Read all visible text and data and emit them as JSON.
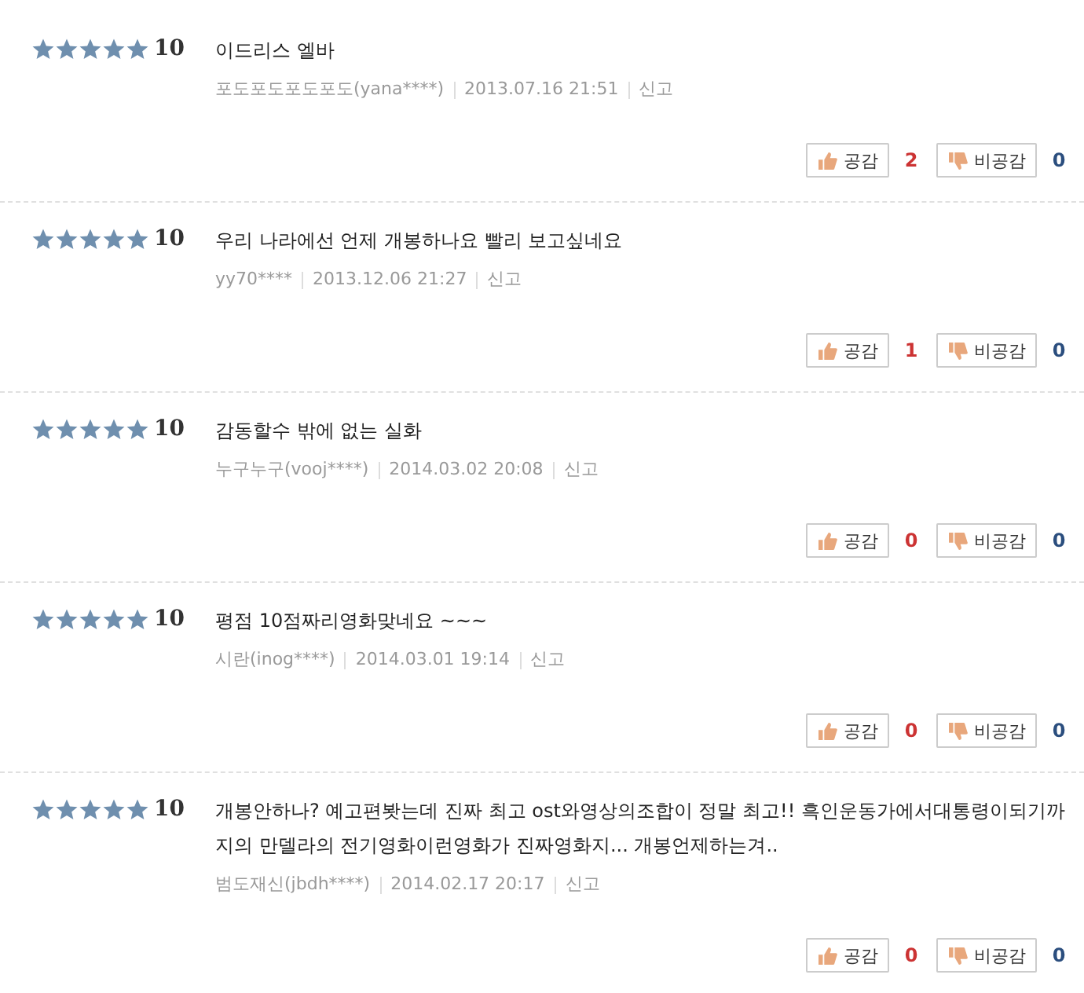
{
  "reviews": [
    {
      "stars": 5,
      "score": "10",
      "text": "이드리스 엘바",
      "author": "포도포도포도포도(yana****)",
      "date": "2013.07.16 21:51",
      "report": "신고",
      "like_label": "공감",
      "like_count": "2",
      "dislike_label": "비공감",
      "dislike_count": "0"
    },
    {
      "stars": 5,
      "score": "10",
      "text": "우리 나라에선 언제 개봉하나요 빨리 보고싶네요",
      "author": "yy70****",
      "date": "2013.12.06 21:27",
      "report": "신고",
      "like_label": "공감",
      "like_count": "1",
      "dislike_label": "비공감",
      "dislike_count": "0"
    },
    {
      "stars": 5,
      "score": "10",
      "text": "감동할수 밖에 없는 실화",
      "author": "누구누구(vooj****)",
      "date": "2014.03.02 20:08",
      "report": "신고",
      "like_label": "공감",
      "like_count": "0",
      "dislike_label": "비공감",
      "dislike_count": "0"
    },
    {
      "stars": 5,
      "score": "10",
      "text": "평점 10점짜리영화맞네요 ~~~",
      "author": "시란(inog****)",
      "date": "2014.03.01 19:14",
      "report": "신고",
      "like_label": "공감",
      "like_count": "0",
      "dislike_label": "비공감",
      "dislike_count": "0"
    },
    {
      "stars": 5,
      "score": "10",
      "text": "개봉안하나? 예고편봣는데 진짜 최고 ost와영상의조합이 정말 최고!! 흑인운동가에서대통령이되기까지의 만델라의 전기영화이런영화가 진짜영화지... 개봉언제하는겨..",
      "author": "범도재신(jbdh****)",
      "date": "2014.02.17 20:17",
      "report": "신고",
      "like_label": "공감",
      "like_count": "0",
      "dislike_label": "비공감",
      "dislike_count": "0"
    }
  ]
}
